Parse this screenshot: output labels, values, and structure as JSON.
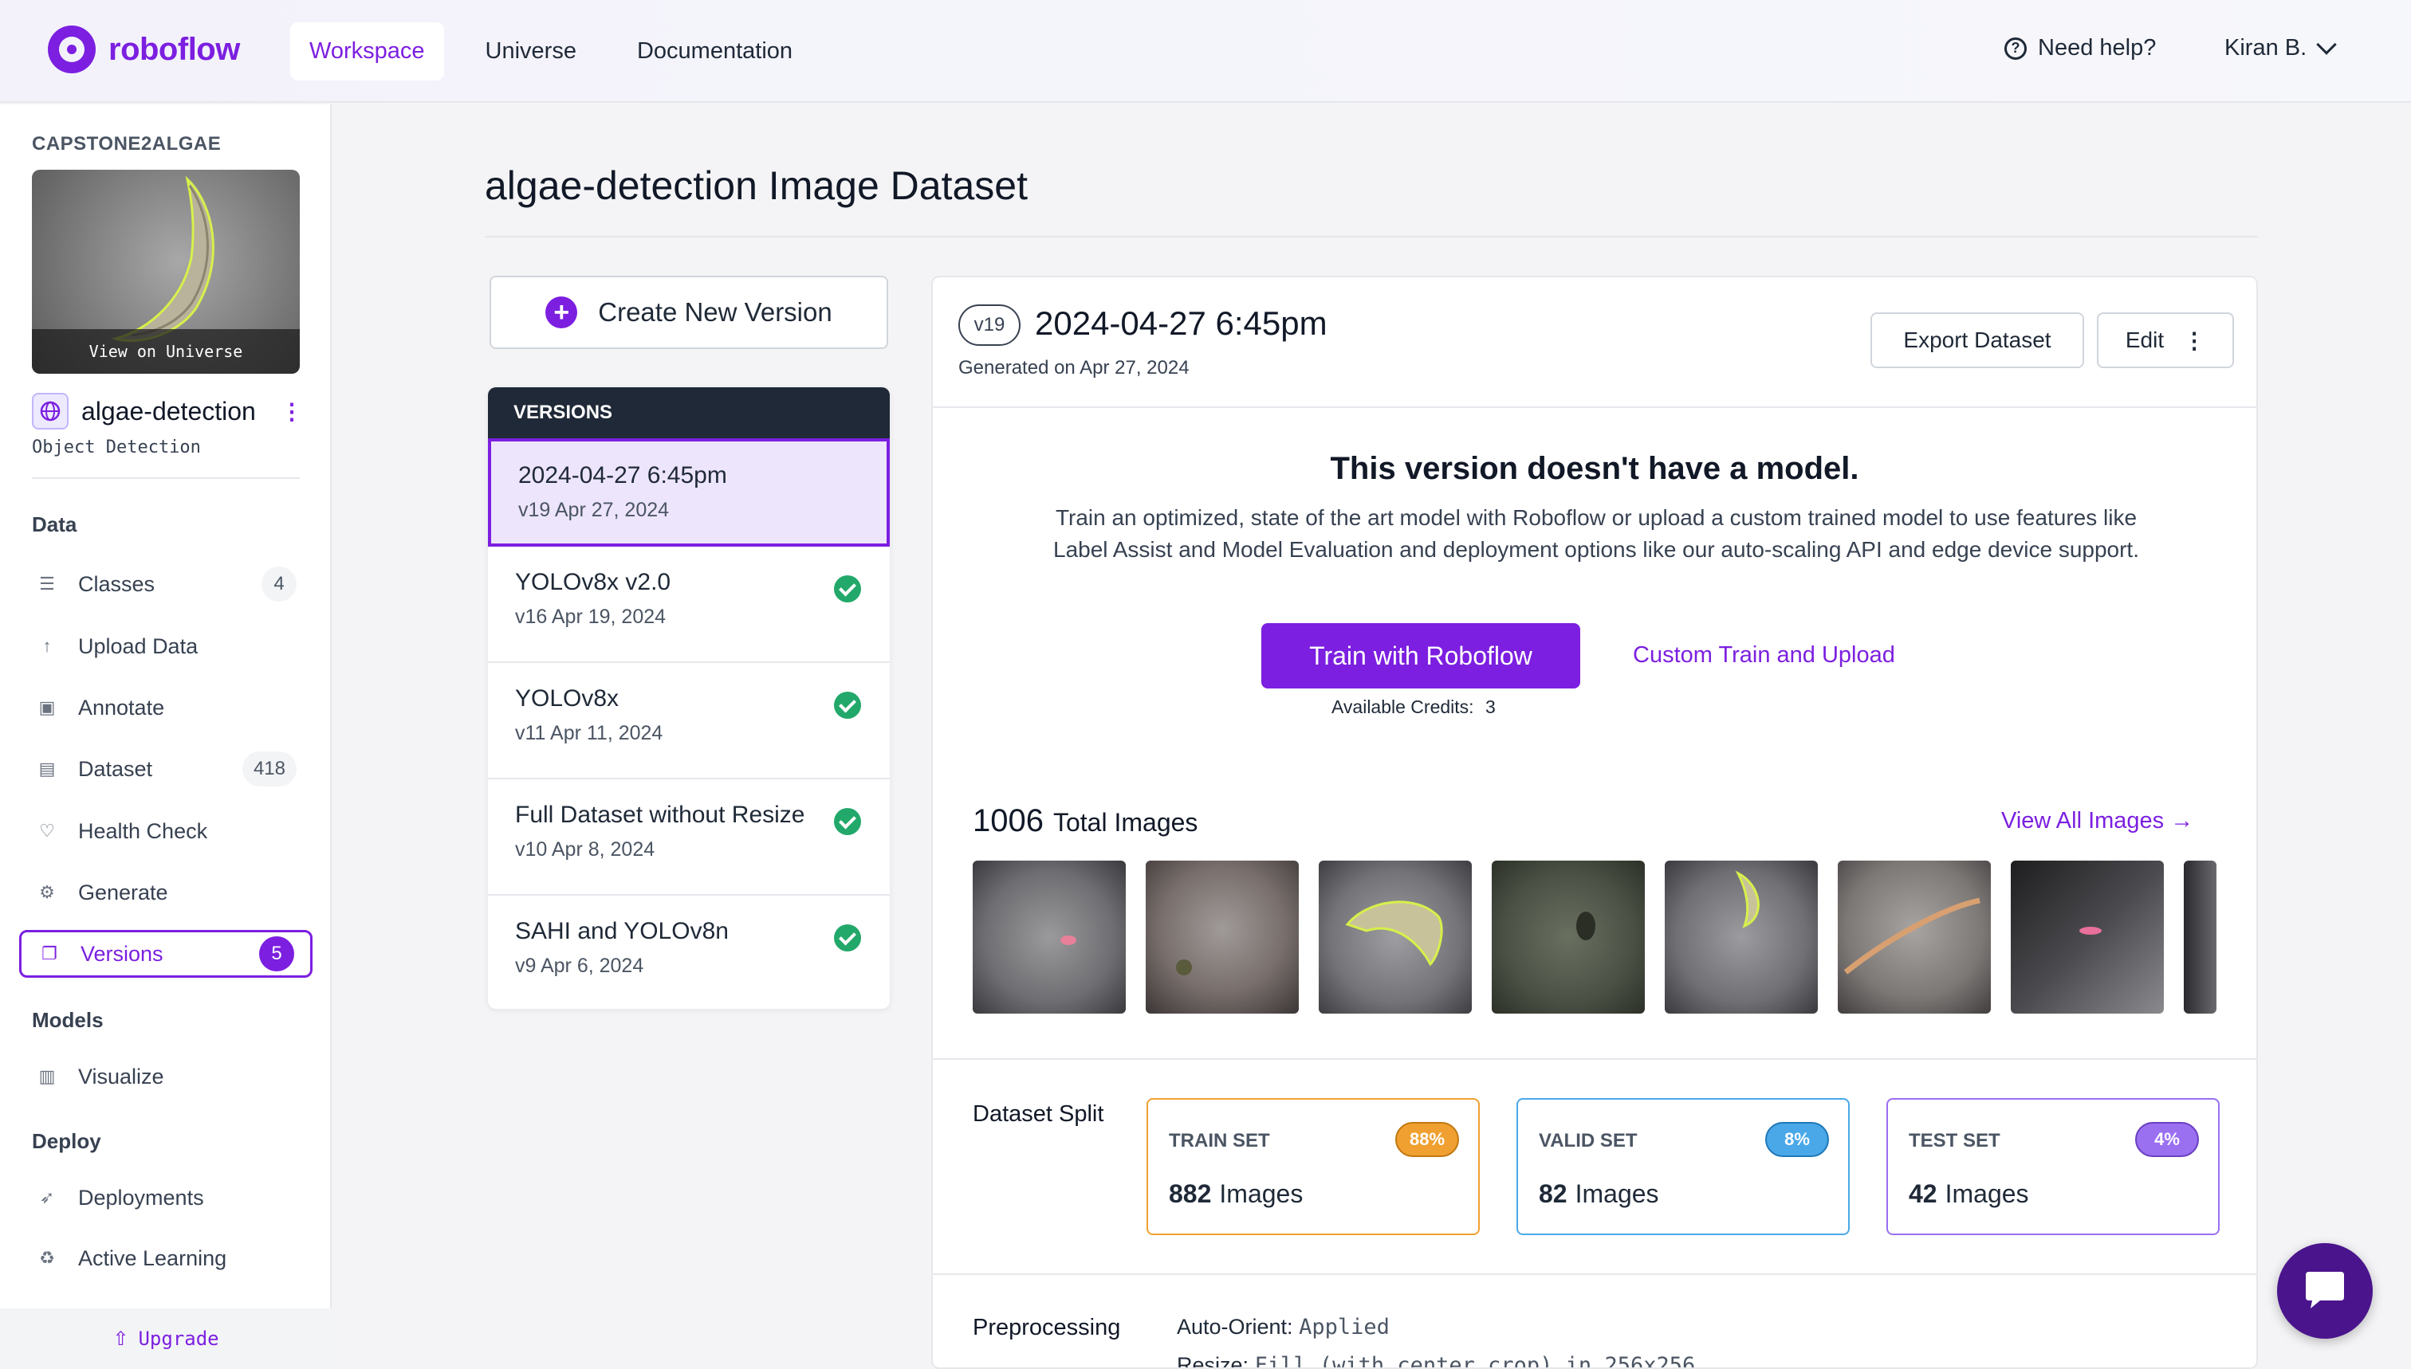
{
  "brand": {
    "name": "roboflow",
    "accent": "#7c1fe0"
  },
  "topnav": {
    "tabs": [
      {
        "label": "Workspace",
        "active": true
      },
      {
        "label": "Universe",
        "active": false
      },
      {
        "label": "Documentation",
        "active": false
      }
    ],
    "help_label": "Need help?",
    "help_icon": "question-circle-icon",
    "user_name": "Kiran B."
  },
  "sidebar": {
    "workspace": "CAPSTONE2ALGAE",
    "thumb_caption": "View on Universe",
    "project_name": "algae-detection",
    "project_type": "Object Detection",
    "sections": {
      "data": "Data",
      "models": "Models",
      "deploy": "Deploy"
    },
    "items": [
      {
        "label": "Classes",
        "icon": "list-icon",
        "count": "4"
      },
      {
        "label": "Upload Data",
        "icon": "upload-arrow-icon"
      },
      {
        "label": "Annotate",
        "icon": "annotate-icon"
      },
      {
        "label": "Dataset",
        "icon": "images-icon",
        "count": "418"
      },
      {
        "label": "Health Check",
        "icon": "heart-pulse-icon"
      },
      {
        "label": "Generate",
        "icon": "generate-icon"
      },
      {
        "label": "Versions",
        "icon": "versions-icon",
        "count": "5",
        "active": true
      },
      {
        "label": "Visualize",
        "icon": "bar-chart-icon"
      },
      {
        "label": "Deployments",
        "icon": "rocket-icon"
      },
      {
        "label": "Active Learning",
        "icon": "recycle-icon"
      }
    ],
    "upgrade_label": "Upgrade"
  },
  "main": {
    "page_title": "algae-detection Image Dataset",
    "create_version_label": "Create New Version",
    "versions_header": "VERSIONS",
    "versions": [
      {
        "name": "2024-04-27 6:45pm",
        "meta": "v19 Apr 27, 2024",
        "selected": true,
        "trained": false
      },
      {
        "name": "YOLOv8x v2.0",
        "meta": "v16 Apr 19, 2024",
        "selected": false,
        "trained": true
      },
      {
        "name": "YOLOv8x",
        "meta": "v11 Apr 11, 2024",
        "selected": false,
        "trained": true
      },
      {
        "name": "Full Dataset without Resize",
        "meta": "v10 Apr 8, 2024",
        "selected": false,
        "trained": true
      },
      {
        "name": "SAHI and YOLOv8n",
        "meta": "v9 Apr 6, 2024",
        "selected": false,
        "trained": true
      }
    ],
    "detail": {
      "version_pill": "v19",
      "title": "2024-04-27 6:45pm",
      "generated": "Generated on Apr 27, 2024",
      "export_label": "Export Dataset",
      "edit_label": "Edit",
      "no_model_title": "This version doesn't have a model.",
      "no_model_text": "Train an optimized, state of the art model with Roboflow or upload a custom trained model to use features like Label Assist and Model Evaluation and deployment options like our auto-scaling API and edge device support.",
      "train_label": "Train with Roboflow",
      "custom_label": "Custom Train and Upload",
      "credits_label": "Available Credits:",
      "credits_value": "3",
      "total_images": "1006",
      "total_label": "Total Images",
      "view_all_label": "View All Images",
      "split_label": "Dataset Split",
      "splits": [
        {
          "name": "TRAIN SET",
          "pct": "88%",
          "count": "882",
          "unit": "Images",
          "color": "#f0a030"
        },
        {
          "name": "VALID SET",
          "pct": "8%",
          "count": "82",
          "unit": "Images",
          "color": "#4aa8e8"
        },
        {
          "name": "TEST SET",
          "pct": "4%",
          "count": "42",
          "unit": "Images",
          "color": "#9a6ff0"
        }
      ],
      "preprocessing_label": "Preprocessing",
      "preprocessing": [
        {
          "key": "Auto-Orient:",
          "value": "Applied"
        },
        {
          "key": "Resize:",
          "value": "Fill (with center crop) in 256x256"
        }
      ]
    }
  },
  "chat_icon": "chat-bubble-icon"
}
